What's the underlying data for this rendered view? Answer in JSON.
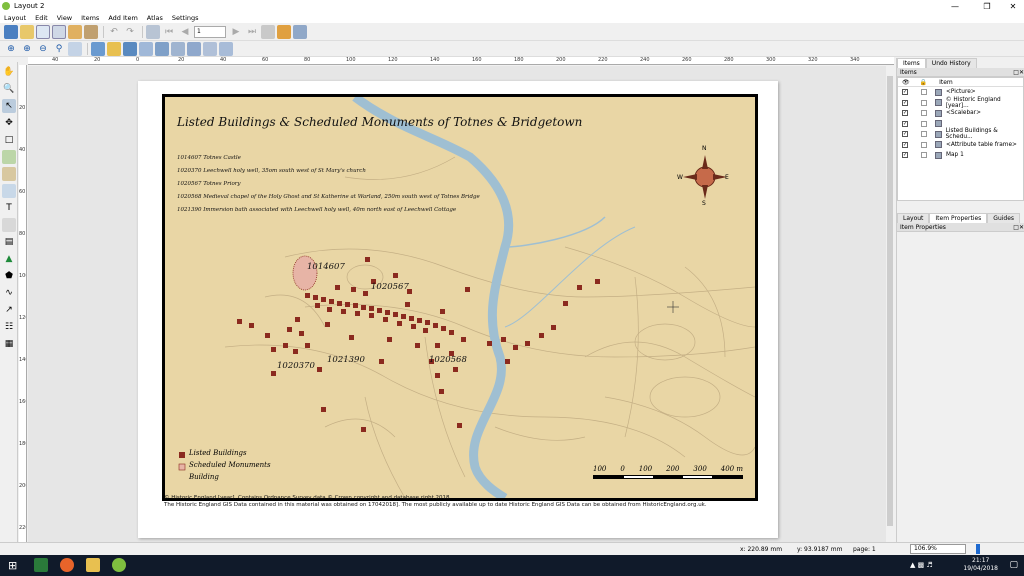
{
  "window": {
    "title": "Layout 2",
    "minimize": "—",
    "maximize": "❐",
    "close": "✕"
  },
  "menu": [
    "Layout",
    "Edit",
    "View",
    "Items",
    "Add Item",
    "Atlas",
    "Settings"
  ],
  "toolbar": {
    "page_number": "1"
  },
  "ruler": {
    "h_ticks": [
      "40",
      "20",
      "0",
      "20",
      "40",
      "60",
      "80",
      "100",
      "120",
      "140",
      "160",
      "180",
      "200",
      "220",
      "240",
      "260",
      "280",
      "300",
      "320",
      "340"
    ],
    "v_ticks": [
      "20",
      "40",
      "60",
      "80",
      "100",
      "120",
      "140",
      "160",
      "180",
      "200",
      "220"
    ]
  },
  "map": {
    "title": "Listed Buildings & Scheduled Monuments of Totnes & Bridgetown",
    "entries": [
      "1014607 Totnes Castle",
      "1020370 Leechwell holy well, 35om south west of St Mary's church",
      "1020567 Totnes Priory",
      "1020568 Medieval chapel of the Holy Ghost and St Katherine at Warland, 250m south west of Totnes Bridge",
      "1021390 Immersion bath associated with Leechwell holy well, 40m north east of Leechwell Cottage"
    ],
    "labels": {
      "castle": "1014607",
      "priory": "1020567",
      "leechwell": "1020370",
      "bath": "1021390",
      "chapel": "1020568"
    },
    "legend": [
      "Listed Buildings",
      "Scheduled Monuments",
      "Building"
    ],
    "scale_labels": [
      "100",
      "0",
      "100",
      "200",
      "300",
      "400 m"
    ],
    "compass": {
      "n": "N",
      "s": "S",
      "e": "E",
      "w": "W"
    },
    "colors": {
      "parchment": "#e9d6a5",
      "building": "#8b2a1f",
      "river": "#9fbfd2",
      "roads": "#b8a27a",
      "monument_fill": "#e7b4a6"
    }
  },
  "attribution": [
    "© Historic England [year]. Contains Ordnance Survey data © Crown copyright and database right 2018",
    "The Historic England GIS Data contained in this material was obtained on 17042018].  The most publicly available up to date Historic England GIS Data can be obtained from HistoricEngland.org.uk."
  ],
  "panel": {
    "top_tabs": [
      "Items",
      "Undo History"
    ],
    "items_title": "Items",
    "items_header": "Item",
    "items": [
      {
        "label": "<Picture>",
        "icon": "picture-icon"
      },
      {
        "label": "© Historic England [year]...",
        "icon": "text-icon"
      },
      {
        "label": "<Scalebar>",
        "icon": "scalebar-icon"
      },
      {
        "label": "",
        "icon": "legend-icon"
      },
      {
        "label": "Listed Buildings & Schedu...",
        "icon": "text-icon"
      },
      {
        "label": "<Attribute table frame>",
        "icon": "table-icon"
      },
      {
        "label": "Map 1",
        "icon": "map-icon"
      }
    ],
    "mid_tabs": [
      "Layout",
      "Item Properties",
      "Guides"
    ],
    "properties_title": "Item Properties"
  },
  "status": {
    "x": "x: 220.89 mm",
    "y": "y: 93.9187 mm",
    "page": "page: 1",
    "zoom": "106.9%"
  },
  "taskbar": {
    "time": "21:17",
    "date": "19/04/2018"
  }
}
